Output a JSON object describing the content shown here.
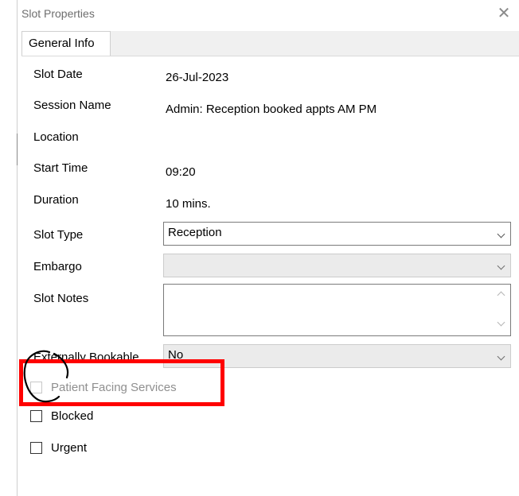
{
  "window": {
    "title": "Slot Properties",
    "close_glyph": "✕"
  },
  "tabs": [
    {
      "label": "General Info"
    }
  ],
  "fields": {
    "slot_date": {
      "label": "Slot Date",
      "value": "26-Jul-2023"
    },
    "session_name": {
      "label": "Session Name",
      "value": "Admin: Reception booked appts AM  PM"
    },
    "location": {
      "label": "Location",
      "value": ""
    },
    "start_time": {
      "label": "Start Time",
      "value": "09:20"
    },
    "duration": {
      "label": "Duration",
      "value": "10 mins."
    },
    "slot_type": {
      "label": "Slot Type",
      "value": "Reception"
    },
    "embargo": {
      "label": "Embargo",
      "value": ""
    },
    "slot_notes": {
      "label": "Slot Notes",
      "value": ""
    },
    "externally_bookable": {
      "label": "Externally Bookable",
      "value": "No"
    }
  },
  "checkboxes": {
    "patient_facing": {
      "label": "Patient Facing Services",
      "checked": false,
      "enabled": false
    },
    "blocked": {
      "label": "Blocked",
      "checked": false,
      "enabled": true
    },
    "urgent": {
      "label": "Urgent",
      "checked": false,
      "enabled": true
    }
  },
  "annotation": {
    "highlight_color": "#ff0000",
    "circle_color": "#000000"
  },
  "icons": {
    "close": "close-icon",
    "dropdown": "chevron-down-icon"
  }
}
